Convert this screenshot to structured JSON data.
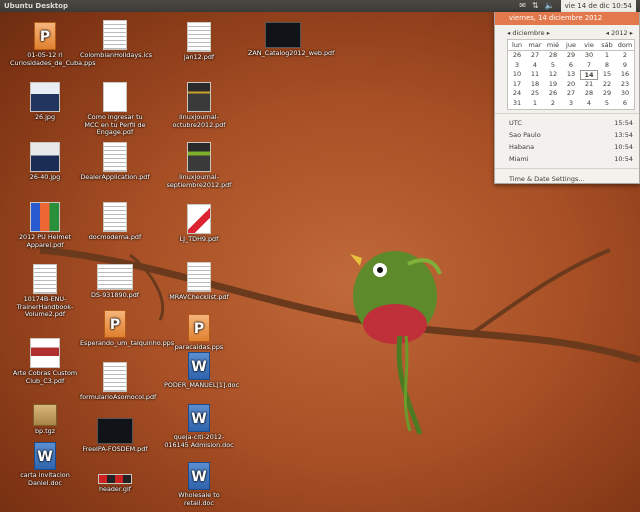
{
  "panel": {
    "title": "Ubuntu Desktop",
    "clock": "vie 14 de dic  10:54",
    "icons": [
      "mail-icon",
      "network-icon",
      "volume-icon"
    ]
  },
  "desktop": {
    "columns": [
      [
        {
          "label": "01-05-12 rl Curiosidades_de_Cuba.pps",
          "thumb": "ppt-word"
        },
        {
          "label": "26.jpg",
          "thumb": "photo-a"
        },
        {
          "label": "26-40.jpg",
          "thumb": "photo-b"
        },
        {
          "label": "2012 PU Helmet Apparel.pdf",
          "thumb": "helmet"
        },
        {
          "label": "10174B-ENU-TrainerHandbook-Volume2.pdf",
          "thumb": "lines"
        },
        {
          "label": "Arte Cobras Custom Club_C3.pdf",
          "thumb": "photo-c"
        },
        {
          "label": "bp.tgz",
          "thumb": "tgz"
        },
        {
          "label": "carta invitacion Daniel.doc",
          "thumb": "word"
        }
      ],
      [
        {
          "label": "ColombianHolidays.ics",
          "thumb": "lines"
        },
        {
          "label": "Como ingresar tu MCC en tu Perfil de Engage.pdf",
          "thumb": "blank"
        },
        {
          "label": "DealerApplication.pdf",
          "thumb": "lines"
        },
        {
          "label": "docmoderna.pdf",
          "thumb": "lines"
        },
        {
          "label": "DS-931890.pdf",
          "thumb": "wide"
        },
        {
          "label": "Esperando_um_talquinho.pps",
          "thumb": "ppt"
        },
        {
          "label": "formularioAsomocol.pdf",
          "thumb": "lines"
        },
        {
          "label": "FreeIPA-FOSDEM.pdf",
          "thumb": "dark"
        },
        {
          "label": "header.gif",
          "thumb": "gif"
        }
      ],
      [
        {
          "label": "jan12.pdf",
          "thumb": "lines"
        },
        {
          "label": "linuxjournal-octubre2012.pdf",
          "thumb": "magazine"
        },
        {
          "label": "linuxjournal-septiembre2012.pdf",
          "thumb": "magazine-green"
        },
        {
          "label": "LJ_TDH9.pdf",
          "thumb": "red-doc"
        },
        {
          "label": "MRAVChecklist.pdf",
          "thumb": "lines"
        },
        {
          "label": "paracaidas.pps",
          "thumb": "ppt"
        },
        {
          "label": "PODER_MANUEL[1].doc",
          "thumb": "word"
        },
        {
          "label": "queja-citi-2012-016145 Admision.doc",
          "thumb": "word"
        },
        {
          "label": "Wholesale to retail.doc",
          "thumb": "word"
        }
      ],
      [
        {
          "label": "ZAN_Catalog2012_web.pdf",
          "thumb": "dark-wide"
        }
      ]
    ]
  },
  "calendar": {
    "header_date": "viernes, 14 diciembre 2012",
    "month": "diciembre",
    "year": "2012",
    "prev": "◂",
    "next": "▸",
    "weekdays": [
      "lun",
      "mar",
      "mié",
      "jue",
      "vie",
      "sáb",
      "dom"
    ],
    "days": [
      "26",
      "27",
      "28",
      "29",
      "30",
      "1",
      "2",
      "3",
      "4",
      "5",
      "6",
      "7",
      "8",
      "9",
      "10",
      "11",
      "12",
      "13",
      "14",
      "15",
      "16",
      "17",
      "18",
      "19",
      "20",
      "21",
      "22",
      "23",
      "24",
      "25",
      "26",
      "27",
      "28",
      "29",
      "30",
      "31",
      "1",
      "2",
      "3",
      "4",
      "5",
      "6"
    ],
    "today_index": 18,
    "timezones": [
      {
        "name": "UTC",
        "time": "15:54"
      },
      {
        "name": "Sao Paulo",
        "time": "13:54"
      },
      {
        "name": "Habana",
        "time": "10:54"
      },
      {
        "name": "Miami",
        "time": "10:54"
      }
    ],
    "settings_label": "Time & Date Settings…"
  },
  "colors": {
    "accent": "#e3784c",
    "panel": "#3c3b37",
    "wallpaper": "#a84f25"
  }
}
